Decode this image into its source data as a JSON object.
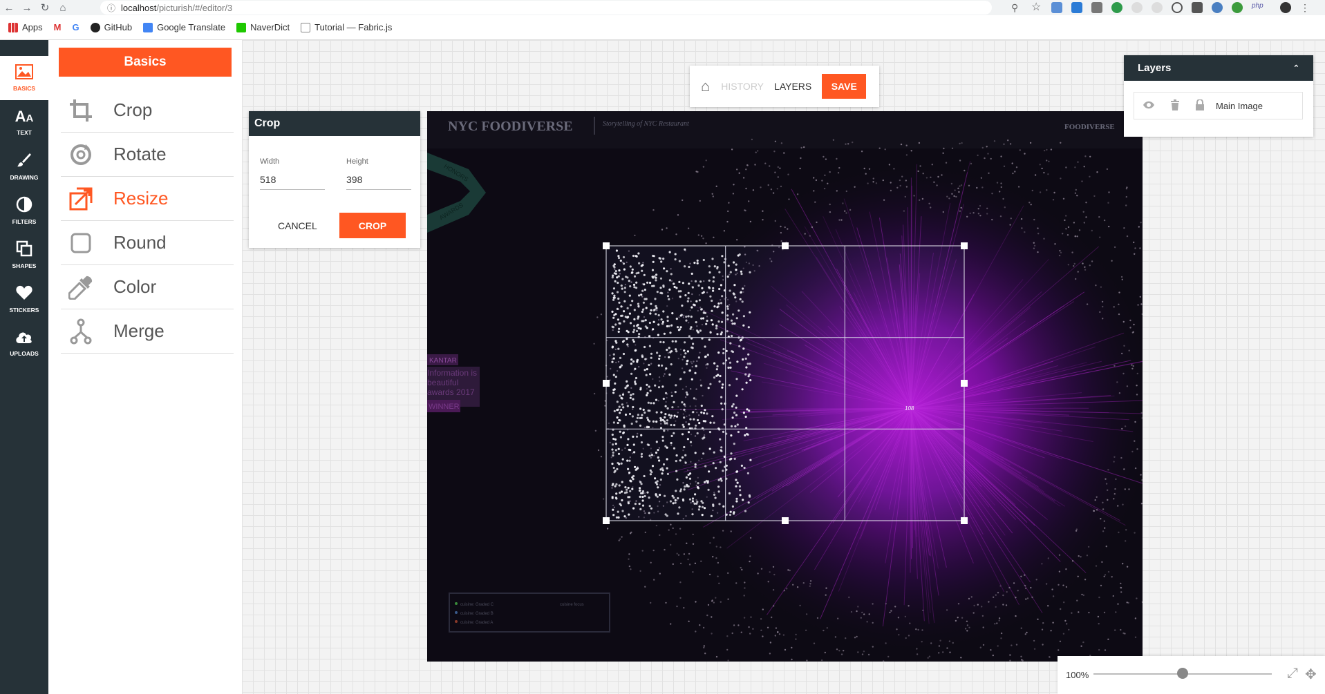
{
  "browser": {
    "url_host": "localhost",
    "url_path": "/picturish/#/editor/3",
    "bookmarks": [
      "Apps",
      "GitHub",
      "Google Translate",
      "NaverDict",
      "Tutorial — Fabric.js"
    ]
  },
  "toolbar": [
    {
      "label": "BASICS",
      "icon": "image-icon",
      "active": true
    },
    {
      "label": "TEXT",
      "icon": "text-icon"
    },
    {
      "label": "DRAWING",
      "icon": "brush-icon"
    },
    {
      "label": "FILTERS",
      "icon": "contrast-icon"
    },
    {
      "label": "SHAPES",
      "icon": "shapes-icon"
    },
    {
      "label": "STICKERS",
      "icon": "heart-icon"
    },
    {
      "label": "UPLOADS",
      "icon": "cloud-upload-icon"
    }
  ],
  "panel": {
    "title": "Basics",
    "items": [
      {
        "label": "Crop",
        "icon": "crop-icon"
      },
      {
        "label": "Rotate",
        "icon": "rotate-icon"
      },
      {
        "label": "Resize",
        "icon": "resize-icon",
        "active": true
      },
      {
        "label": "Round",
        "icon": "round-corner-icon"
      },
      {
        "label": "Color",
        "icon": "eyedropper-icon"
      },
      {
        "label": "Merge",
        "icon": "merge-icon"
      }
    ]
  },
  "topmenu": {
    "history": "HISTORY",
    "layers": "LAYERS",
    "save": "SAVE"
  },
  "crop_dialog": {
    "title": "Crop",
    "width_label": "Width",
    "width_value": "518",
    "height_label": "Height",
    "height_value": "398",
    "cancel": "CANCEL",
    "crop": "CROP"
  },
  "image": {
    "title": "NYC FOODIVERSE",
    "subtitle": "Storytelling of NYC Restaurant",
    "brand": "FOODIVERSE",
    "ribbon_top": "HONORS",
    "ribbon_bottom": "AWARDS",
    "badge_lines": [
      "KANTAR",
      "Information is",
      "beautiful",
      "awards 2017",
      "WINNER"
    ],
    "center_label": "108",
    "legend": [
      "cuisine: Graded C",
      "cuisine: Graded B",
      "cuisine: Graded A"
    ],
    "legend_note": "cuisine focus"
  },
  "layers": {
    "title": "Layers",
    "item_name": "Main Image"
  },
  "zoom": {
    "value": "100%",
    "level": 0.5
  },
  "colors": {
    "accent": "#ff5722",
    "dark": "#263238"
  }
}
